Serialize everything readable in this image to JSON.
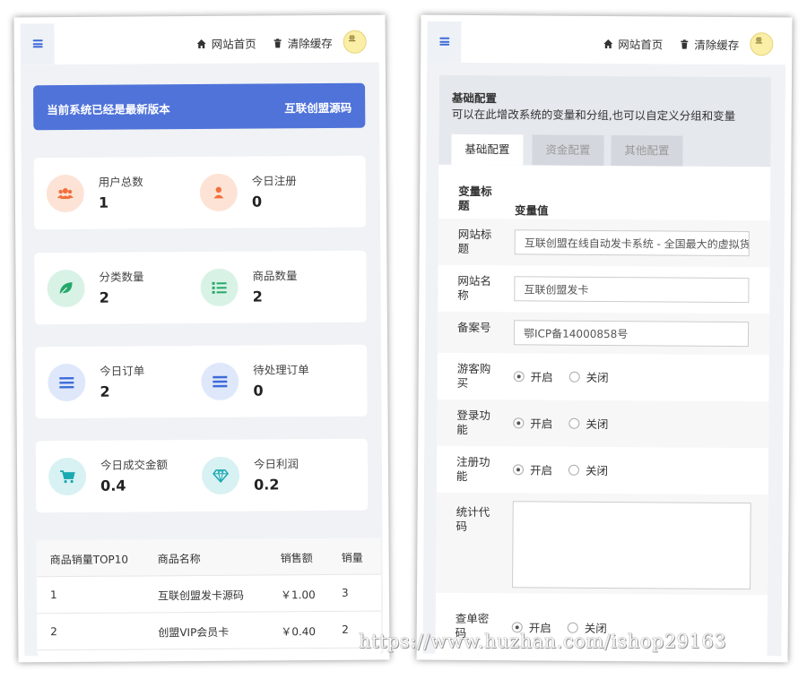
{
  "colors": {
    "accent": "#4f73d9",
    "orange_bg": "#fde3d6",
    "orange_icon": "#f26f3b",
    "green_bg": "#d9f2e6",
    "green_icon": "#26a86a",
    "blue_bg": "#dfe8fb",
    "blue_icon": "#3d6bd8",
    "teal_bg": "#d8f1f2",
    "teal_icon": "#1aa9b2",
    "save_btn": "#19a98b"
  },
  "header": {
    "nav": [
      {
        "icon": "home-icon",
        "label": "网站首页"
      },
      {
        "icon": "trash-icon",
        "label": "清除缓存"
      }
    ],
    "avatar_text": "亖"
  },
  "dashboard": {
    "banner": {
      "left": "当前系统已经是最新版本",
      "right": "互联创盟源码"
    },
    "stats": [
      {
        "icon": "users-icon",
        "label": "用户总数",
        "value": "1"
      },
      {
        "icon": "user-icon",
        "label": "今日注册",
        "value": "0"
      },
      {
        "icon": "leaf-icon",
        "label": "分类数量",
        "value": "2"
      },
      {
        "icon": "list-icon",
        "label": "商品数量",
        "value": "2"
      },
      {
        "icon": "bars-icon",
        "label": "今日订单",
        "value": "2"
      },
      {
        "icon": "bars-icon",
        "label": "待处理订单",
        "value": "0"
      },
      {
        "icon": "cart-icon",
        "label": "今日成交金额",
        "value": "0.4"
      },
      {
        "icon": "diamond-icon",
        "label": "今日利润",
        "value": "0.2"
      }
    ],
    "sales_table": {
      "headers": [
        "商品销量TOP10",
        "商品名称",
        "销售额",
        "销量"
      ],
      "rows": [
        [
          "1",
          "互联创盟发卡源码",
          "￥1.00",
          "3"
        ],
        [
          "2",
          "创盟VIP会员卡",
          "￥0.40",
          "2"
        ]
      ]
    }
  },
  "config": {
    "title": "基础配置",
    "description": "可以在此增改系统的变量和分组,也可以自定义分组和变量",
    "tabs": [
      "基础配置",
      "资金配置",
      "其他配置"
    ],
    "col_headers": [
      "变量标题",
      "变量值"
    ],
    "fields": {
      "site_title": {
        "label": "网站标题",
        "value": "互联创盟在线自动发卡系统 - 全国最大的虚拟货"
      },
      "site_name": {
        "label": "网站名称",
        "value": "互联创盟发卡"
      },
      "icp": {
        "label": "备案号",
        "value": "鄂ICP备14000858号"
      },
      "guest_buy": {
        "label": "游客购买"
      },
      "login": {
        "label": "登录功能"
      },
      "register": {
        "label": "注册功能"
      },
      "stats_code": {
        "label": "统计代码"
      },
      "order_query_pwd": {
        "label": "查单密码"
      }
    },
    "radio_on": "开启",
    "radio_off": "关闭"
  },
  "watermark": "https://www.huzhan.com/ishop29163"
}
